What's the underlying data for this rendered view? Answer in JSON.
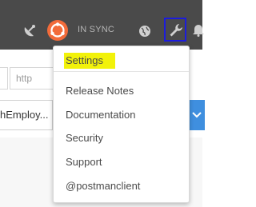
{
  "header": {
    "sync_status": "IN SYNC"
  },
  "request": {
    "url_placeholder": "http",
    "environment_label": "hEmploy..."
  },
  "menu": {
    "settings_label": "Settings",
    "items": [
      {
        "label": "Release Notes"
      },
      {
        "label": "Documentation"
      },
      {
        "label": "Security"
      },
      {
        "label": "Support"
      },
      {
        "label": "@postmanclient"
      }
    ]
  },
  "colors": {
    "header_bg": "#4a4a4a",
    "sync_accent": "#f26b3a",
    "highlight": "#f2f20a",
    "annotation_box": "#1c1cdc",
    "send_button": "#3f8fdf"
  }
}
